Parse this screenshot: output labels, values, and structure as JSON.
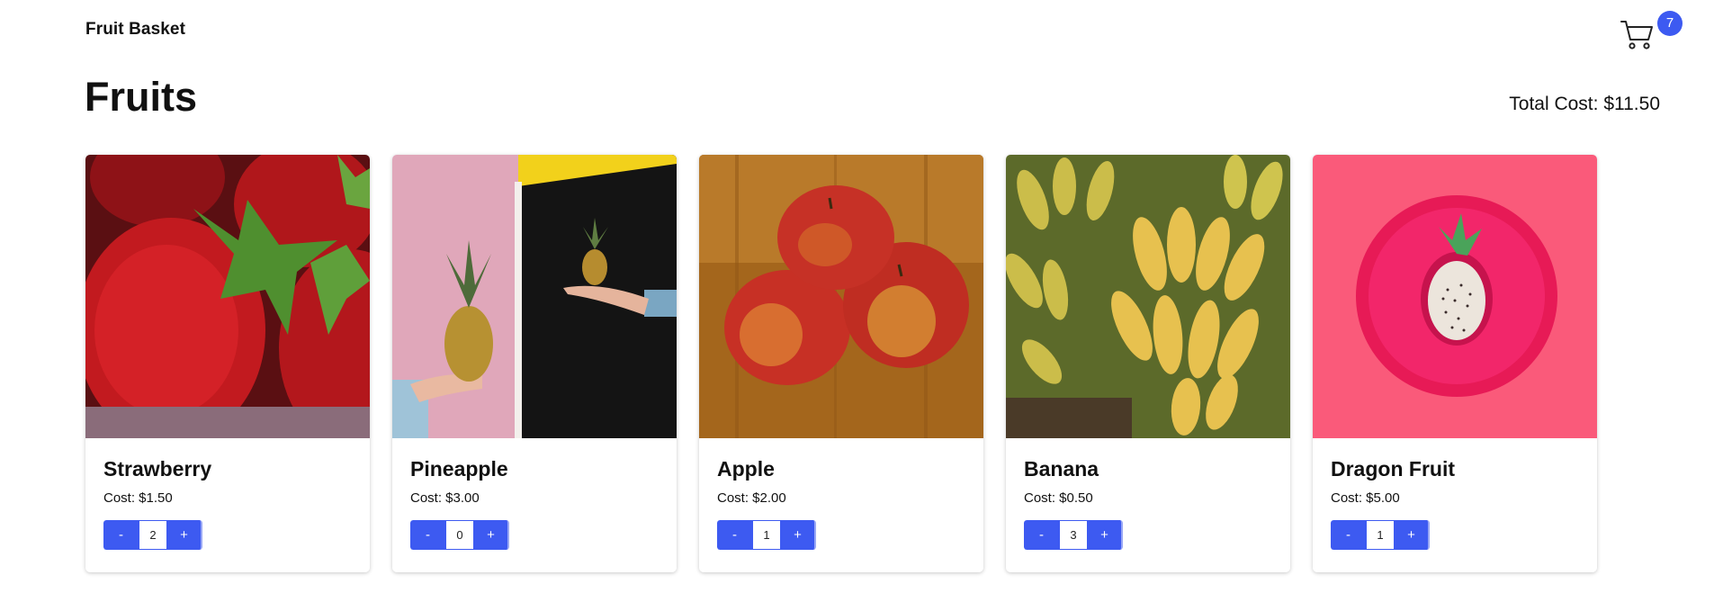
{
  "header": {
    "brand": "Fruit Basket",
    "cart_count": "7"
  },
  "page": {
    "title": "Fruits",
    "total_label": "Total Cost:",
    "total_value": "$11.50"
  },
  "products": [
    {
      "name": "Strawberry",
      "cost": "Cost: $1.50",
      "qty": "2",
      "minus": "-",
      "plus": "+"
    },
    {
      "name": "Pineapple",
      "cost": "Cost: $3.00",
      "qty": "0",
      "minus": "-",
      "plus": "+"
    },
    {
      "name": "Apple",
      "cost": "Cost: $2.00",
      "qty": "1",
      "minus": "-",
      "plus": "+"
    },
    {
      "name": "Banana",
      "cost": "Cost: $0.50",
      "qty": "3",
      "minus": "-",
      "plus": "+"
    },
    {
      "name": "Dragon Fruit",
      "cost": "Cost: $5.00",
      "qty": "1",
      "minus": "-",
      "plus": "+"
    }
  ],
  "colors": {
    "accent": "#3d5af1"
  },
  "icons": {
    "cart": "shopping-cart-icon"
  }
}
